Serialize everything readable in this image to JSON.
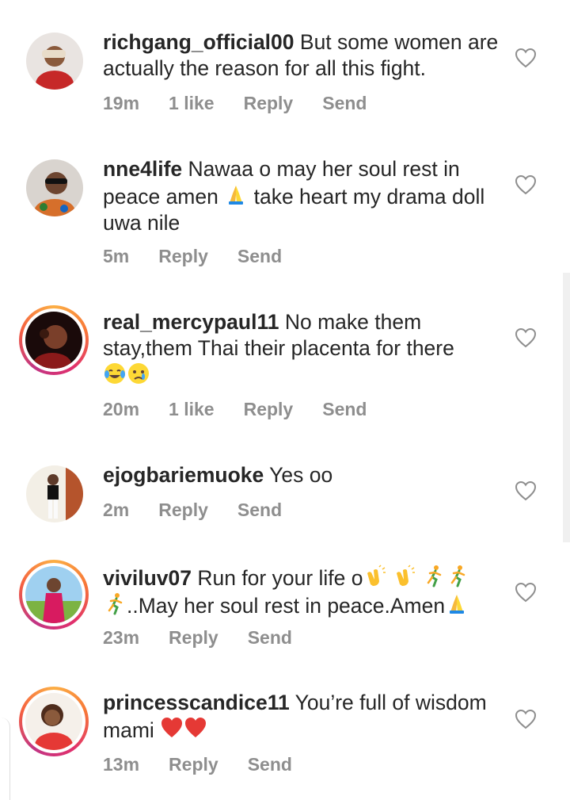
{
  "comments": [
    {
      "username": "richgang_official00",
      "text": "But some women are actually the reason for all this fight.",
      "time": "19m",
      "likes": "1 like",
      "reply": "Reply",
      "send": "Send"
    },
    {
      "username": "nne4life",
      "text_before": "Nawaa o may her soul rest in peace amen",
      "text_after": "take heart my drama doll uwa nile",
      "time": "5m",
      "reply": "Reply",
      "send": "Send"
    },
    {
      "username": "real_mercypaul11",
      "text": "No make them stay,them Thai their placenta for there",
      "time": "20m",
      "likes": "1 like",
      "reply": "Reply",
      "send": "Send"
    },
    {
      "username": "ejogbariemuoke",
      "text": "Yes oo",
      "time": "2m",
      "reply": "Reply",
      "send": "Send"
    },
    {
      "username": "viviluv07",
      "text_before": "Run for your life o",
      "text_after": "..May her soul rest in peace.Amen",
      "time": "23m",
      "reply": "Reply",
      "send": "Send"
    },
    {
      "username": "princesscandice11",
      "text": "You’re full of wisdom mami",
      "time": "13m",
      "reply": "Reply",
      "send": "Send"
    }
  ],
  "icons": {
    "like": "heart-outline-icon",
    "pray": "folded-hands-emoji",
    "joy": "tears-of-joy-emoji",
    "cry": "crying-face-emoji",
    "clap": "clapping-hands-emoji",
    "run": "running-person-emoji",
    "heart": "red-heart-emoji"
  },
  "colors": {
    "text": "#262626",
    "meta": "#8e8e8e",
    "story_ring": "#e1306c"
  }
}
